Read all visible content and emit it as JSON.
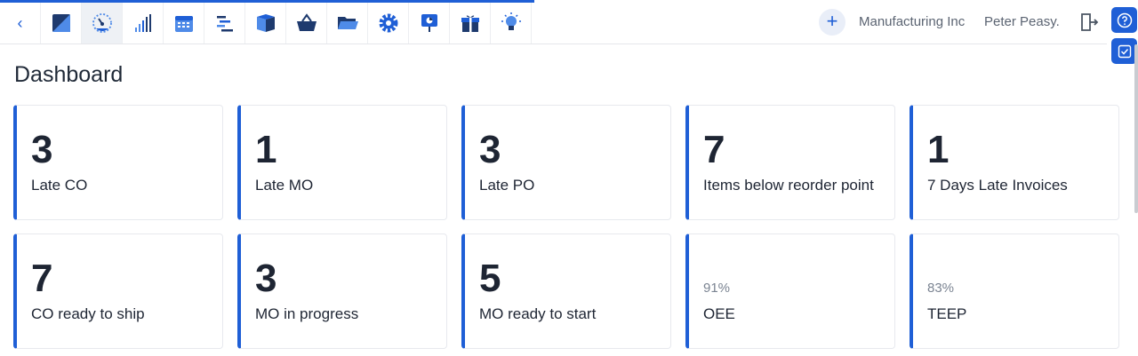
{
  "header": {
    "company": "Manufacturing Inc",
    "user": "Peter Peasy.",
    "nav_icons": [
      "back-icon",
      "shortcut-icon",
      "dashboard-gauge-icon",
      "stats-icon",
      "calendar-icon",
      "planning-icon",
      "product-box-icon",
      "basket-icon",
      "folder-icon",
      "settings-icon",
      "presentation-icon",
      "gift-icon",
      "lightbulb-icon"
    ]
  },
  "page": {
    "title": "Dashboard"
  },
  "kpis": [
    {
      "value": "3",
      "label": "Late CO"
    },
    {
      "value": "1",
      "label": "Late MO"
    },
    {
      "value": "3",
      "label": "Late PO"
    },
    {
      "value": "7",
      "label": "Items below reorder point"
    },
    {
      "value": "1",
      "label": "7 Days Late Invoices"
    },
    {
      "value": "7",
      "label": "CO ready to ship"
    },
    {
      "value": "3",
      "label": "MO in progress"
    },
    {
      "value": "5",
      "label": "MO ready to start"
    },
    {
      "value": "91%",
      "label": "OEE"
    },
    {
      "value": "83%",
      "label": "TEEP"
    }
  ],
  "colors": {
    "accent": "#1f5fd6",
    "text": "#1e2533",
    "muted": "#7b8492"
  }
}
